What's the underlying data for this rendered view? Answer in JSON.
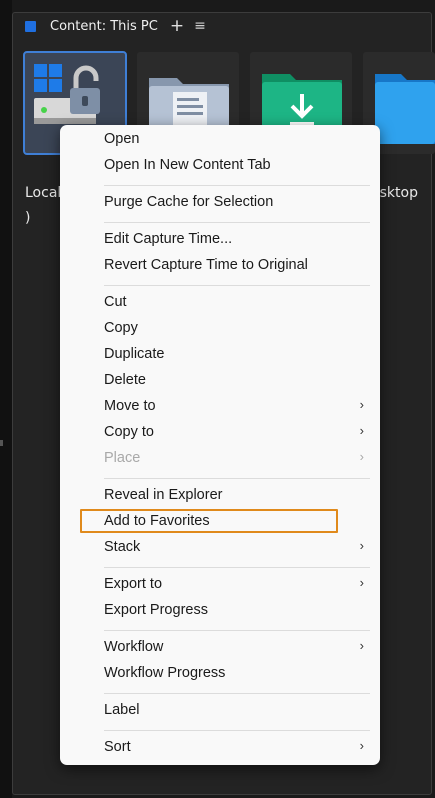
{
  "panel": {
    "title": "Content: This PC",
    "plus_icon": "+",
    "menu_icon": "≡"
  },
  "thumbnails": [
    {
      "name": "local-disk",
      "label": "Local",
      "label2": ")"
    },
    {
      "name": "documents",
      "label": ""
    },
    {
      "name": "downloads",
      "label": ""
    },
    {
      "name": "desktop",
      "label": "esktop"
    }
  ],
  "context_menu": {
    "items": [
      {
        "label": "Open"
      },
      {
        "label": "Open In New Content Tab"
      },
      {
        "label": "Purge Cache for Selection"
      },
      {
        "label": "Edit Capture Time..."
      },
      {
        "label": "Revert Capture Time to Original"
      },
      {
        "label": "Cut"
      },
      {
        "label": "Copy"
      },
      {
        "label": "Duplicate"
      },
      {
        "label": "Delete"
      },
      {
        "label": "Move to",
        "chevron": "›"
      },
      {
        "label": "Copy to",
        "chevron": "›"
      },
      {
        "label": "Place",
        "chevron": "›",
        "disabled": true
      },
      {
        "label": "Reveal in Explorer"
      },
      {
        "label": "Add to Favorites",
        "highlighted": true
      },
      {
        "label": "Stack",
        "chevron": "›"
      },
      {
        "label": "Export to",
        "chevron": "›"
      },
      {
        "label": "Export Progress"
      },
      {
        "label": "Workflow",
        "chevron": "›"
      },
      {
        "label": "Workflow Progress"
      },
      {
        "label": "Label"
      },
      {
        "label": "Sort",
        "chevron": "›"
      }
    ]
  },
  "colors": {
    "accent": "#1f6fe0",
    "highlight_border": "#e08a1c",
    "menu_bg": "#f9f9f9"
  }
}
